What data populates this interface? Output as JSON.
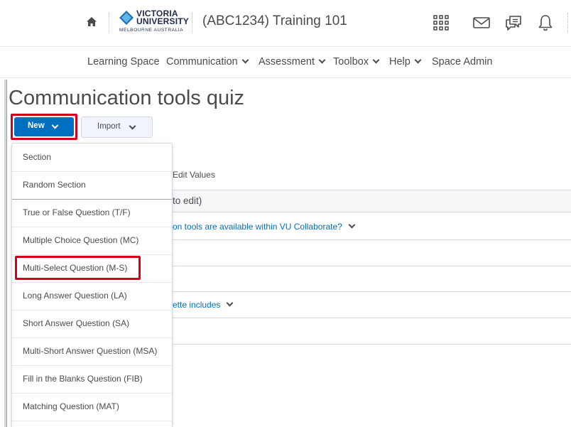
{
  "header": {
    "logo_line1": "VICTORIA",
    "logo_line2": "UNIVERSITY",
    "logo_sub": "MELBOURNE AUSTRALIA",
    "course_title": "(ABC1234) Training 101",
    "icons": [
      "home-icon",
      "waffle-icon",
      "mail-icon",
      "chat-icon",
      "bell-icon"
    ]
  },
  "nav": {
    "items": [
      {
        "label": "Learning Space"
      },
      {
        "label": "Communication"
      },
      {
        "label": "Assessment"
      },
      {
        "label": "Toolbox"
      },
      {
        "label": "Help"
      },
      {
        "label": "Space Admin"
      }
    ]
  },
  "page": {
    "title": "Communication tools quiz",
    "new_button": "New",
    "import_button": "Import"
  },
  "background": {
    "edit_values": "Edit Values",
    "click_to_edit": "to edit)",
    "question1": "on tools are available within VU Collaborate?",
    "question2": "ette includes"
  },
  "dropdown": {
    "items": [
      {
        "label": "Section"
      },
      {
        "label": "Random Section"
      },
      {
        "label": "True or False Question (T/F)"
      },
      {
        "label": "Multiple Choice Question (MC)"
      },
      {
        "label": "Multi-Select Question (M-S)"
      },
      {
        "label": "Long Answer Question (LA)"
      },
      {
        "label": "Short Answer Question (SA)"
      },
      {
        "label": "Multi-Short Answer Question (MSA)"
      },
      {
        "label": "Fill in the Blanks Question (FIB)"
      },
      {
        "label": "Matching Question (MAT)"
      }
    ]
  },
  "colors": {
    "primary": "#006fbf",
    "highlight": "#d0021b",
    "text": "#494c4e"
  }
}
